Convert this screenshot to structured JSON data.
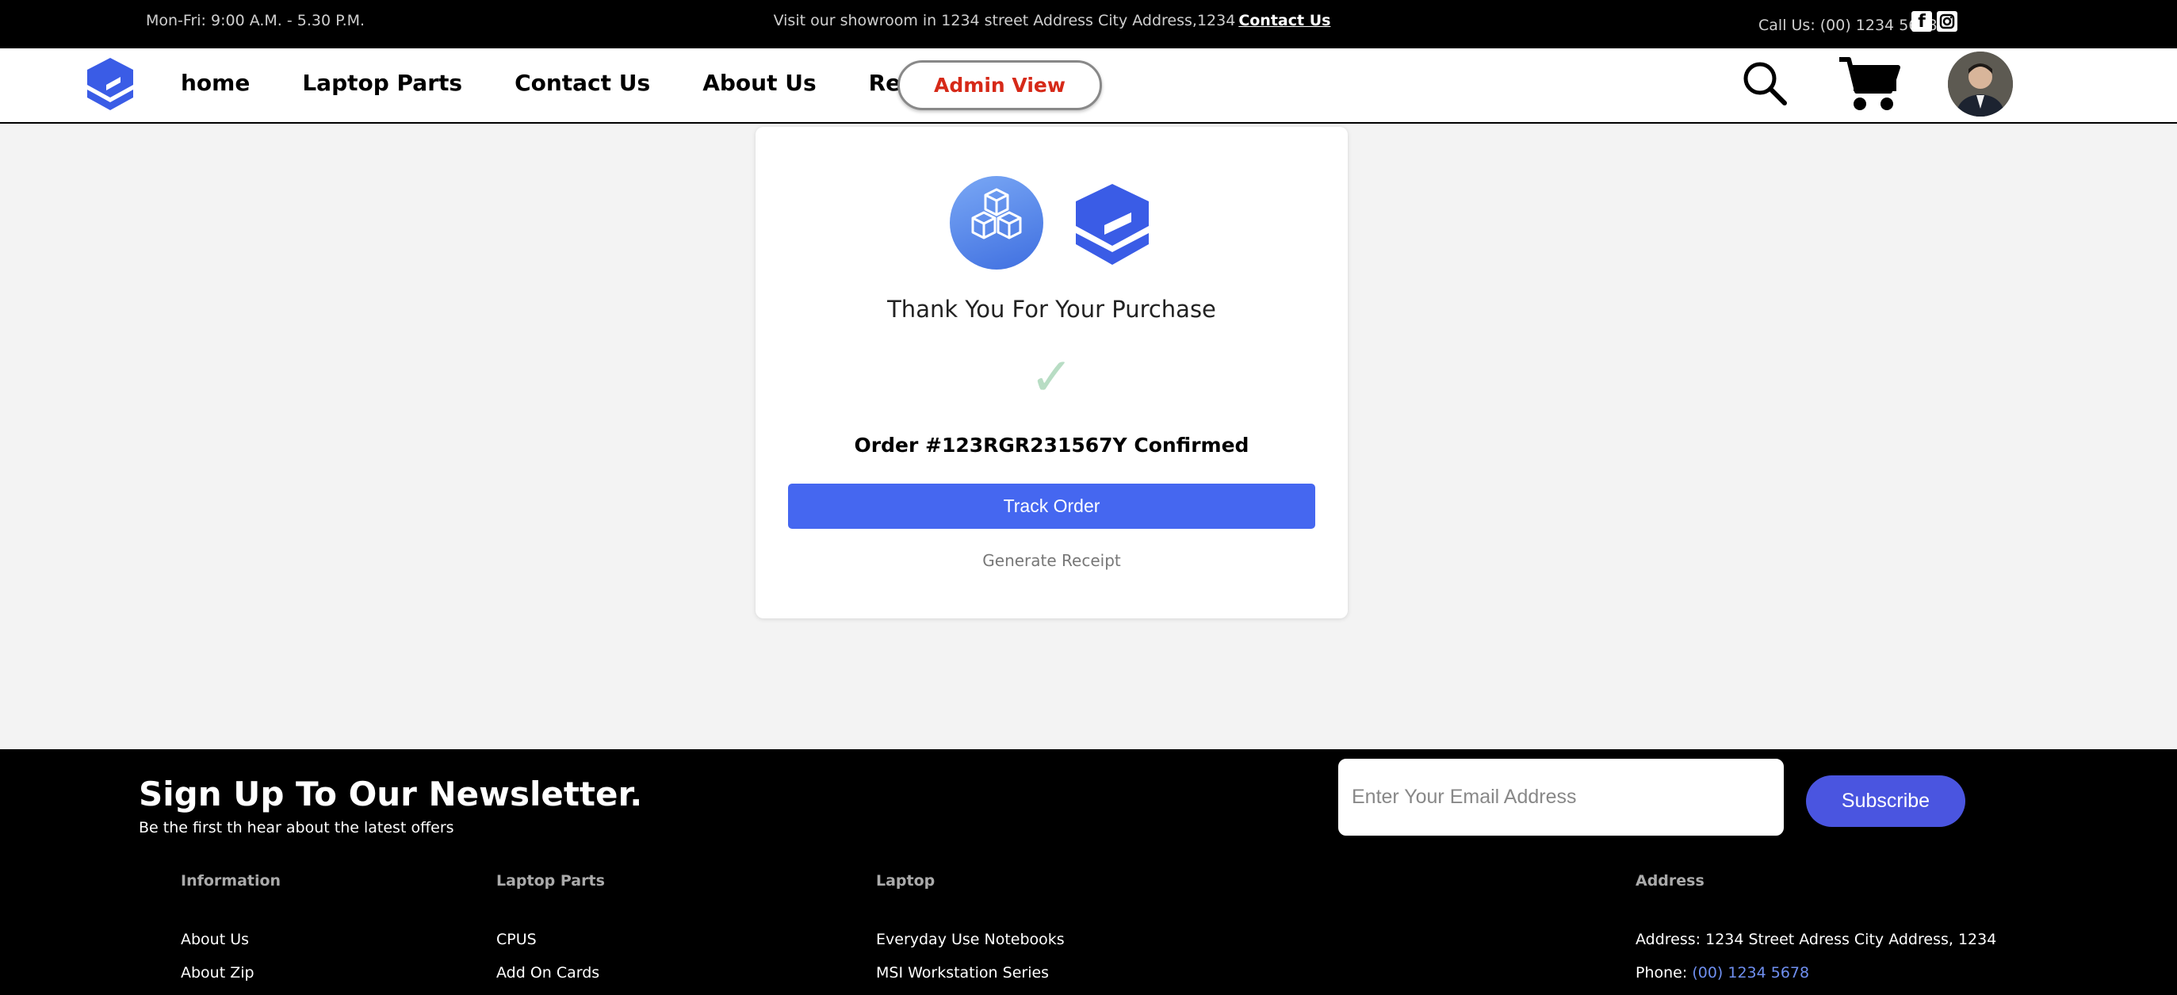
{
  "topbar": {
    "hours": "Mon-Fri: 9:00 A.M. - 5.30 P.M.",
    "showroom_text": "Visit our showroom in 1234 street Address City Address,1234",
    "contact_link": "Contact Us",
    "call": "Call Us: (00) 1234 5678"
  },
  "nav": {
    "items": [
      "home",
      "Laptop Parts",
      "Contact Us",
      "About Us",
      "Repairs"
    ],
    "admin_button": "Admin View"
  },
  "card": {
    "thanks": "Thank You For Your Purchase",
    "order": "Order #123RGR231567Y Confirmed",
    "track_button": "Track Order",
    "receipt_link": "Generate Receipt"
  },
  "footer": {
    "newsletter_title": "Sign Up To Our Newsletter.",
    "newsletter_sub": "Be the first th hear about the latest offers",
    "email_placeholder": "Enter Your Email Address",
    "subscribe_button": "Subscribe",
    "columns": [
      {
        "heading": "Information",
        "items": [
          "About Us",
          "About Zip"
        ]
      },
      {
        "heading": "Laptop Parts",
        "items": [
          "CPUS",
          "Add On Cards"
        ]
      },
      {
        "heading": "Laptop",
        "items": [
          "Everyday Use Notebooks",
          "MSI Workstation Series"
        ]
      },
      {
        "heading": "Address",
        "address": "Address: 1234 Street Adress City Address, 1234",
        "phone_label": "Phone:",
        "phone_value": "(00) 1234 5678"
      }
    ]
  },
  "colors": {
    "brand_blue": "#4567f0",
    "admin_red": "#d62918",
    "subscribe_blue": "#4a55e0"
  }
}
